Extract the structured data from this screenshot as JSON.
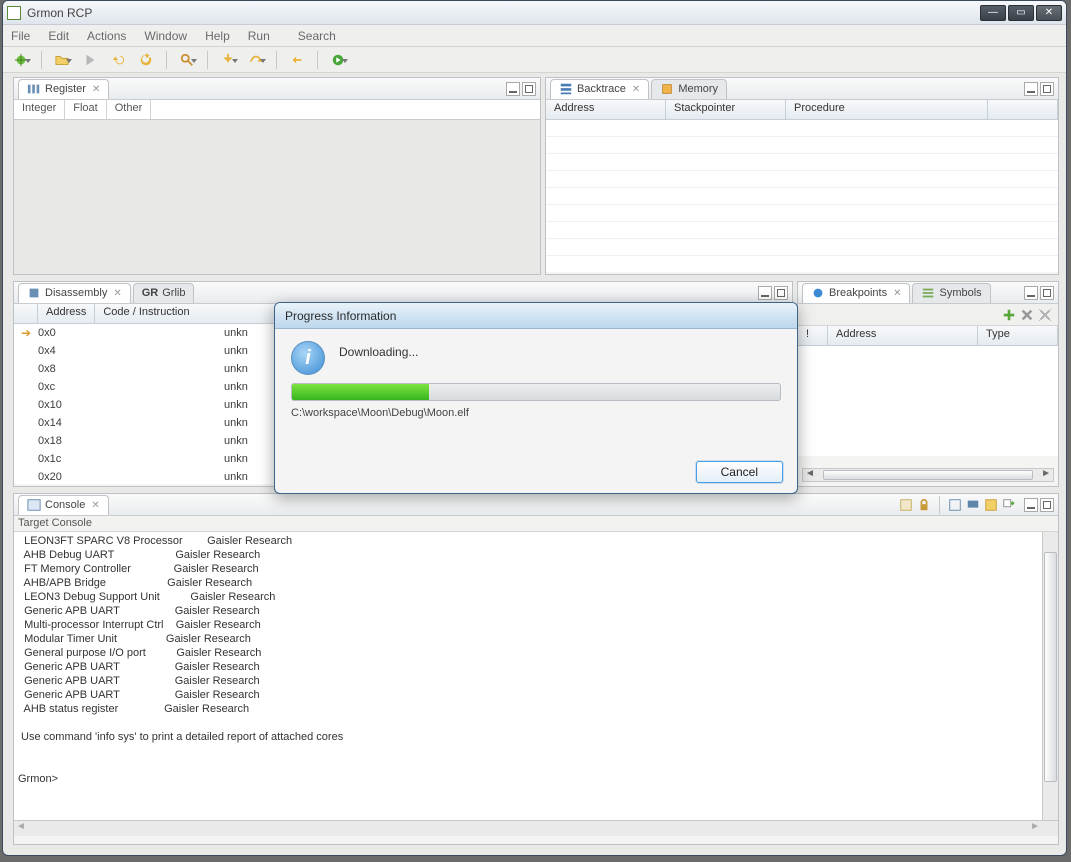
{
  "window": {
    "title": "Grmon RCP"
  },
  "menu": [
    "File",
    "Edit",
    "Actions",
    "Window",
    "Help",
    "Run",
    "Search"
  ],
  "register_panel": {
    "title": "Register",
    "subtabs": [
      "Integer",
      "Float",
      "Other"
    ]
  },
  "backtrace_panel": {
    "tabs": [
      "Backtrace",
      "Memory"
    ],
    "columns": [
      "Address",
      "Stackpointer",
      "Procedure"
    ]
  },
  "disassembly_panel": {
    "tabs": [
      "Disassembly",
      "Grlib"
    ],
    "columns": [
      "Address",
      "Code / Instruction"
    ],
    "rows": [
      {
        "addr": "0x0",
        "code": "unkn",
        "current": true
      },
      {
        "addr": "0x4",
        "code": "unkn",
        "current": false
      },
      {
        "addr": "0x8",
        "code": "unkn",
        "current": false
      },
      {
        "addr": "0xc",
        "code": "unkn",
        "current": false
      },
      {
        "addr": "0x10",
        "code": "unkn",
        "current": false
      },
      {
        "addr": "0x14",
        "code": "unkn",
        "current": false
      },
      {
        "addr": "0x18",
        "code": "unkn",
        "current": false
      },
      {
        "addr": "0x1c",
        "code": "unkn",
        "current": false
      },
      {
        "addr": "0x20",
        "code": "unkn",
        "current": false
      }
    ]
  },
  "breakpoints_panel": {
    "tabs": [
      "Breakpoints",
      "Symbols"
    ],
    "columns": [
      "!",
      "Address",
      "Type"
    ]
  },
  "console_panel": {
    "tab": "Console",
    "subtitle": "Target Console",
    "text": "  LEON3FT SPARC V8 Processor        Gaisler Research\n  AHB Debug UART                    Gaisler Research\n  FT Memory Controller              Gaisler Research\n  AHB/APB Bridge                    Gaisler Research\n  LEON3 Debug Support Unit          Gaisler Research\n  Generic APB UART                  Gaisler Research\n  Multi-processor Interrupt Ctrl    Gaisler Research\n  Modular Timer Unit                Gaisler Research\n  General purpose I/O port          Gaisler Research\n  Generic APB UART                  Gaisler Research\n  Generic APB UART                  Gaisler Research\n  Generic APB UART                  Gaisler Research\n  AHB status register               Gaisler Research\n\n Use command 'info sys' to print a detailed report of attached cores\n\n\nGrmon>"
  },
  "dialog": {
    "title": "Progress Information",
    "message": "Downloading...",
    "progress_percent": 28,
    "path": "C:\\workspace\\Moon\\Debug\\Moon.elf",
    "cancel": "Cancel"
  }
}
